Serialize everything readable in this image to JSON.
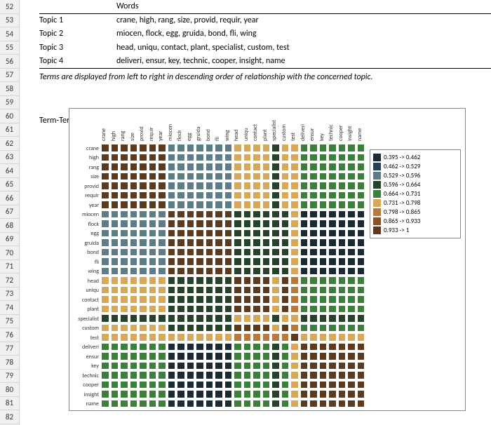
{
  "row_start": 52,
  "row_count": 31,
  "header": {
    "words": "Words"
  },
  "topics": [
    {
      "label": "Topic 1",
      "words": "crane, high, rang, size, provid, requir, year"
    },
    {
      "label": "Topic 2",
      "words": "miocen, flock, egg, gruida, bond, fli, wing"
    },
    {
      "label": "Topic 3",
      "words": "head, uniqu, contact, plant, specialist, custom, test"
    },
    {
      "label": "Topic 4",
      "words": "deliveri, ensur, key, technic, cooper, insight, name"
    }
  ],
  "note": "Terms are displayed from left to right in descending order of relationship with the concerned topic.",
  "matrix_title": "Term-Term correlation matrix:",
  "chart_data": {
    "type": "heatmap",
    "title": "",
    "xlabel": "",
    "ylabel": "",
    "categories": [
      "crane",
      "high",
      "rang",
      "size",
      "provid",
      "requir",
      "year",
      "miocen",
      "flock",
      "egg",
      "gruida",
      "bond",
      "fli",
      "wing",
      "head",
      "uniqu",
      "contact",
      "plant",
      "specialist",
      "custom",
      "test",
      "deliveri",
      "ensur",
      "key",
      "technic",
      "cooper",
      "insight",
      "name"
    ],
    "cell_size_px": 13.5,
    "legend_bins": [
      {
        "label": "0.395 -> 0.462",
        "color": "#1b2933"
      },
      {
        "label": "0.462 -> 0.529",
        "color": "#23405a"
      },
      {
        "label": "0.529 -> 0.596",
        "color": "#5c7d88"
      },
      {
        "label": "0.596 -> 0.664",
        "color": "#27422b"
      },
      {
        "label": "0.664 -> 0.731",
        "color": "#3d7d3d"
      },
      {
        "label": "0.731 -> 0.798",
        "color": "#d8a85a"
      },
      {
        "label": "0.798 -> 0.865",
        "color": "#b87a3a"
      },
      {
        "label": "0.865 -> 0.933",
        "color": "#8a5229"
      },
      {
        "label": "0.933 -> 1",
        "color": "#5c3a20"
      }
    ],
    "groups": [
      {
        "range": [
          0,
          6
        ],
        "self_bin": 8,
        "cross": {
          "g1": 2,
          "g2": 5,
          "g3": 4
        }
      },
      {
        "range": [
          7,
          13
        ],
        "self_bin": 8,
        "cross": {
          "g0": 2,
          "g2": 3,
          "g3": 0
        }
      },
      {
        "range": [
          14,
          20
        ],
        "self_bin": 8,
        "cross": {
          "g0": 5,
          "g1": 3,
          "g3": 4
        }
      },
      {
        "range": [
          21,
          27
        ],
        "self_bin": 8,
        "cross": {
          "g0": 4,
          "g1": 0,
          "g2": 4
        }
      }
    ],
    "outliers": {
      "18": {
        "self_bin": 3,
        "rowcol_bins": {
          "g0": 3,
          "g1": 3,
          "g2": 5,
          "g3": 3
        }
      },
      "20": {
        "self_bin": 8,
        "rowcol_bins": {
          "g0": 5,
          "g1": 5,
          "g2": 6,
          "g3": 5
        }
      }
    }
  }
}
